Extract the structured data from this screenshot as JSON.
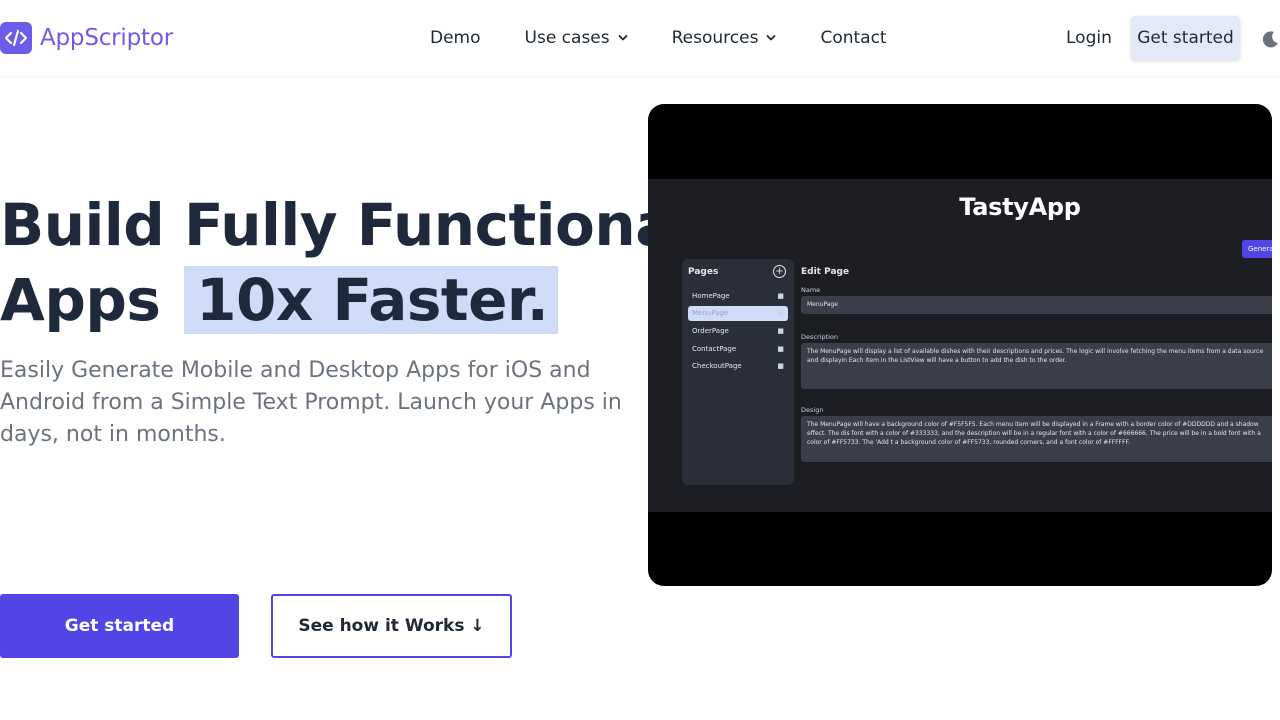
{
  "header": {
    "logo_text": "AppScriptor",
    "nav": [
      {
        "label": "Demo"
      },
      {
        "label": "Use cases"
      },
      {
        "label": "Resources"
      },
      {
        "label": "Contact"
      }
    ],
    "login_label": "Login",
    "get_started_label": "Get started",
    "theme_icon": "moon-icon"
  },
  "hero": {
    "title_line1": "Build Fully Functional",
    "title_line2_prefix": "Apps",
    "title_highlight": "10x Faster.",
    "subtitle": "Easily Generate Mobile and Desktop Apps for iOS and Android from a Simple Text Prompt. Launch your Apps in days, not in months.",
    "primary_cta": "Get started",
    "secondary_cta": "See how it Works ↓"
  },
  "video": {
    "app_title": "TastyApp",
    "generate_label": "Genera",
    "pages_heading": "Pages",
    "add_icon": "plus-circle-icon",
    "pages": [
      "HomePage",
      "MenuPage",
      "OrderPage",
      "ContactPage",
      "CheckoutPage"
    ],
    "edit_heading": "Edit Page",
    "name_label": "Name",
    "name_value": "MenuPage",
    "description_label": "Description",
    "description_value": "The MenuPage will display a list of available dishes with their descriptions and prices. The logic will involve fetching the menu items from a data source and displayin Each item in the ListView will have a button to add the dish to the order.",
    "design_label": "Design",
    "design_value": "The MenuPage will have a background color of #F5F5F5. Each menu item will be displayed in a Frame with a border color of #DDDDDD and a shadow effect. The dis font with a color of #333333, and the description will be in a regular font with a color of #666666. The price will be in a bold font with a color of #FF5733. The 'Add t a background color of #FF5733, rounded corners, and a font color of #FFFFFF."
  },
  "colors": {
    "brand": "#6d5ce8",
    "primary_button": "#5146e5",
    "highlight": "#cfdcf8",
    "heading": "#1e293b",
    "subtext": "#6b7280"
  }
}
